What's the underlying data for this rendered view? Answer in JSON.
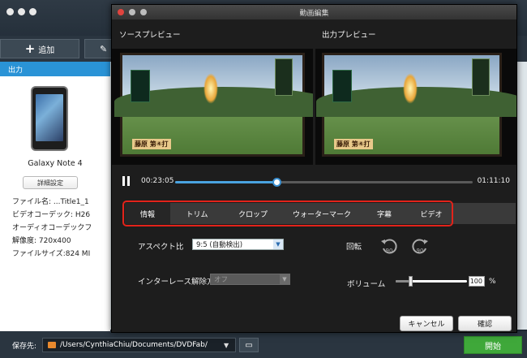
{
  "main": {
    "toolbar": {
      "add_label": "追加",
      "edit_label": "✎"
    },
    "output_tab": "出力",
    "device": {
      "name": "Galaxy Note 4",
      "details_button": "詳細設定",
      "info": [
        "ファイル名: ...Title1_1",
        "ビデオコーデック: H26",
        "オーディオコーデックフ",
        "解像度: 720x400",
        "ファイルサイズ:824 MI"
      ]
    },
    "save": {
      "label": "保存先:",
      "path": "/Users/CynthiaChiu/Documents/DVDFab/",
      "start_button": "開始"
    }
  },
  "dialog": {
    "title": "動画編集",
    "source_preview": "ソースプレビュー",
    "output_preview": "出力プレビュー",
    "caption": "藤原 第④打",
    "playback": {
      "current_time": "00:23:05",
      "total_time": "01:11:10",
      "progress_fraction": 0.34
    },
    "tabs": [
      "情報",
      "トリム",
      "クロップ",
      "ウォーターマーク",
      "字幕",
      "ビデオ"
    ],
    "active_tab": 0,
    "aspect": {
      "label": "アスペクト比",
      "value": "9:5 (自動検出)"
    },
    "rotate": {
      "label": "回転",
      "left_value": "90",
      "right_value": "90"
    },
    "deinterlace": {
      "label": "インターレース解除方:",
      "value": "オフ"
    },
    "volume": {
      "label": "ボリューム",
      "value": "100",
      "unit": "%",
      "fraction": 0.2
    },
    "buttons": {
      "cancel": "キャンセル",
      "ok": "確認"
    }
  },
  "colors": {
    "accent_blue": "#2a93d6",
    "highlight_red": "#e2231a",
    "start_green": "#3fa83a"
  }
}
